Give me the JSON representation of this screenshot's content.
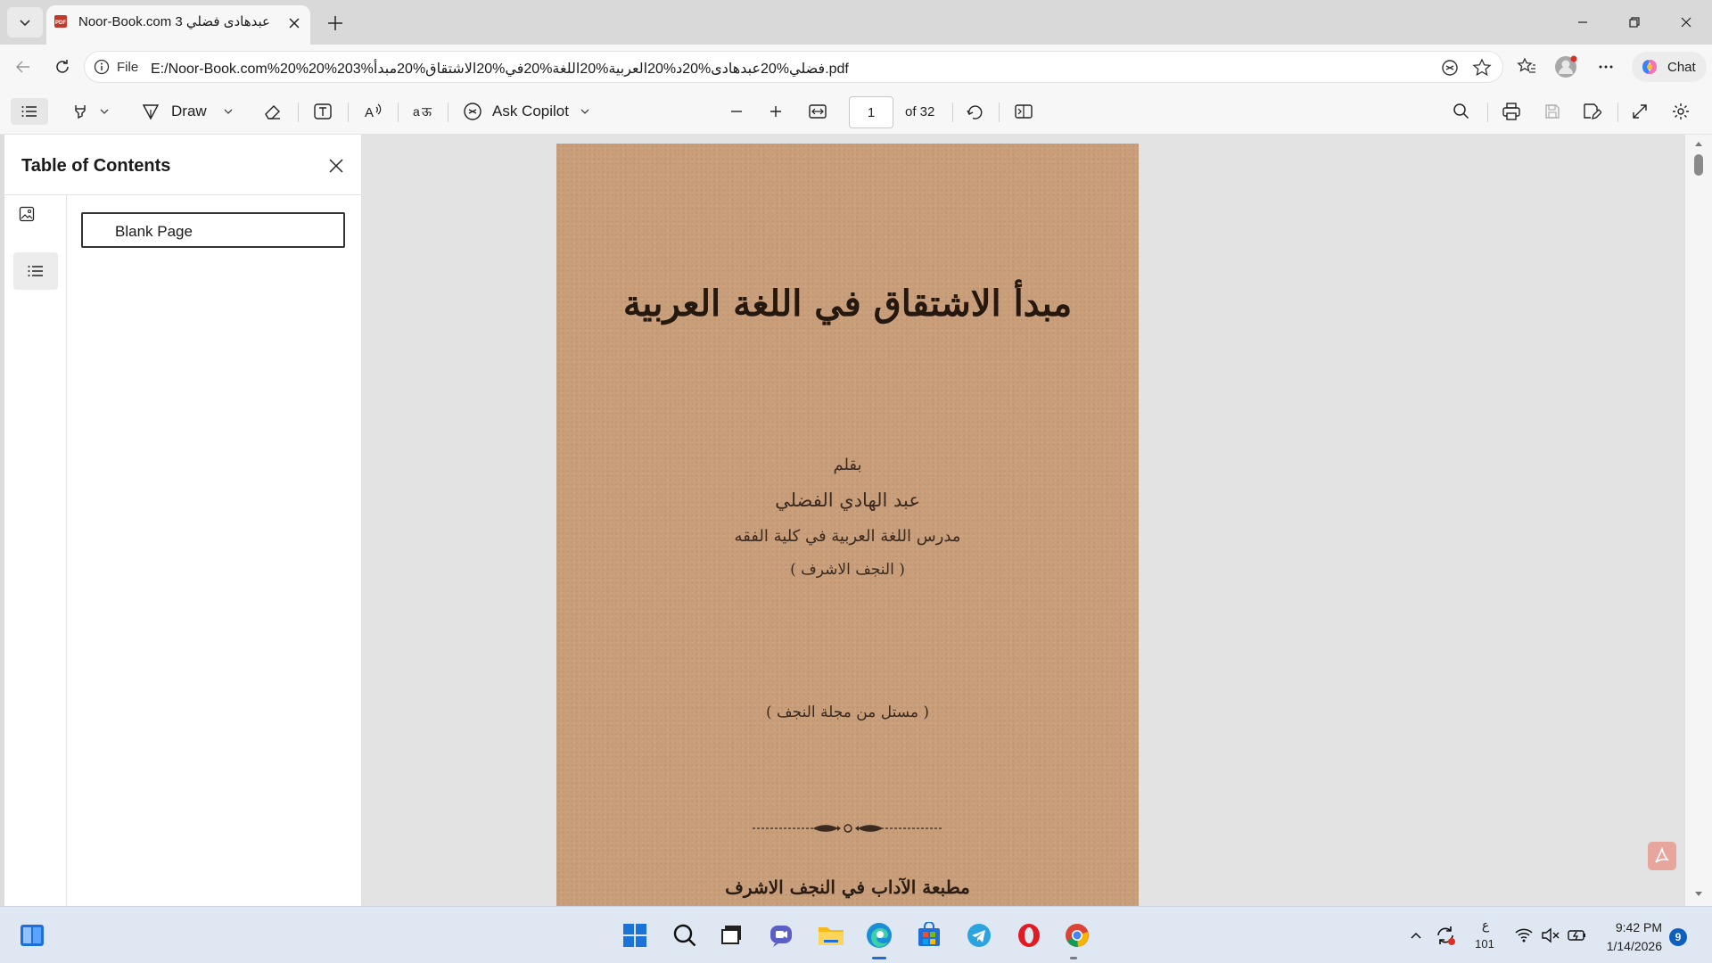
{
  "browser": {
    "tab": {
      "title": "Noor-Book.com عبدهادى فضلي 3",
      "favicon": "pdf-icon"
    },
    "address": {
      "scheme_label": "File",
      "url": "E:/Noor-Book.com%20%20%203%فضلي%20عبدهادى%20د%20العربية%20اللغة%20في%20الاشتقاق%20مبدأ.pdf"
    },
    "chat_label": "Chat"
  },
  "pdf_toolbar": {
    "draw_label": "Draw",
    "ask_copilot_label": "Ask Copilot",
    "page_number": "1",
    "page_count": "of 32"
  },
  "sidebar": {
    "title": "Table of Contents",
    "items": [
      {
        "label": "Blank Page"
      }
    ]
  },
  "document": {
    "title": "مبدأ الاشتقاق في اللغة العربية",
    "by_label": "بقلم",
    "author": "عبد الهادي الفضلي",
    "position": "مدرس اللغة العربية في كلية الفقه",
    "place": "( النجف الاشرف )",
    "offprint": "( مستل من مجلة النجف )",
    "press": "مطبعة الآداب في النجف الاشرف"
  },
  "taskbar": {
    "time": "9:42 PM",
    "date": "1/14/2026",
    "notification_count": "9",
    "ime_top": "ع",
    "ime_bottom": "101",
    "apps": [
      "windows-start",
      "search",
      "task-view",
      "teams",
      "file-explorer",
      "edge",
      "microsoft-store",
      "telegram",
      "opera",
      "chrome"
    ]
  },
  "colors": {
    "page_bg": "#c99e7a",
    "accent": "#0f5fbf"
  }
}
